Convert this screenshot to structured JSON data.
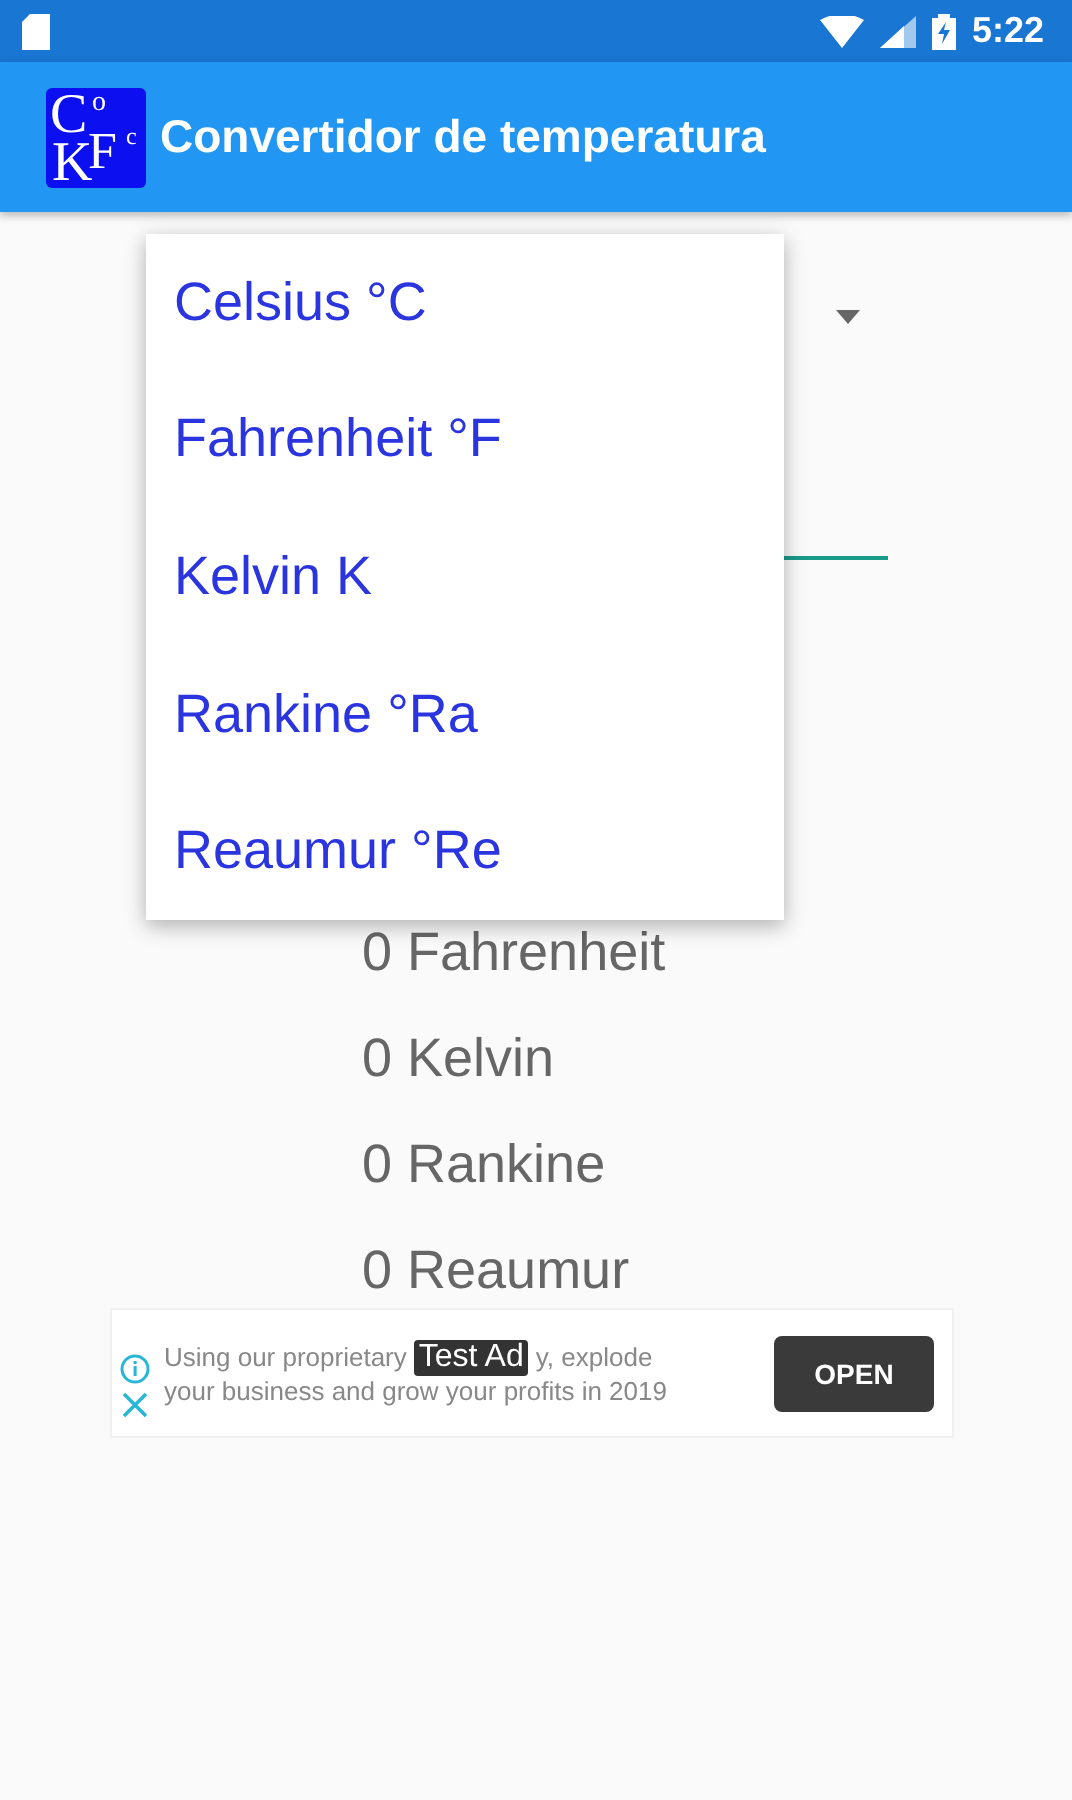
{
  "status_bar": {
    "time": "5:22"
  },
  "app_bar": {
    "logo_letters": [
      "C",
      "o",
      "K",
      "F",
      "c"
    ],
    "title": "Convertidor de temperatura"
  },
  "results": [
    "0 Fahrenheit",
    "0 Kelvin",
    "0 Rankine",
    "0 Reaumur"
  ],
  "dropdown_menu": {
    "items": [
      {
        "label": "Celsius °C"
      },
      {
        "label": "Fahrenheit °F"
      },
      {
        "label": "Kelvin K"
      },
      {
        "label": "Rankine °Ra"
      },
      {
        "label": "Reaumur °Re"
      }
    ]
  },
  "ad": {
    "text_before": "Using our proprietary",
    "badge": "Test Ad",
    "text_after": "y, explode",
    "text_rest": "your business and grow your profits in 2019",
    "button": "OPEN"
  }
}
